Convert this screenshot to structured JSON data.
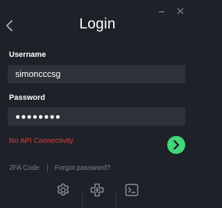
{
  "header": {
    "title": "Login"
  },
  "window_controls": {
    "minimize_icon": "minimize-icon",
    "close_icon": "close-icon"
  },
  "form": {
    "username_label": "Username",
    "username_value": "simoncccsg",
    "password_label": "Password",
    "password_mask": "●●●●●●●●"
  },
  "status": {
    "error_text": "No API Connectivity",
    "error_color": "#e23b3b"
  },
  "accent_color": "#41d77a",
  "footer": {
    "twofa_label": "2FA Code",
    "forgot_label": "Forgot password?",
    "tools": [
      "gear-icon",
      "add-icon",
      "terminal-icon"
    ]
  }
}
